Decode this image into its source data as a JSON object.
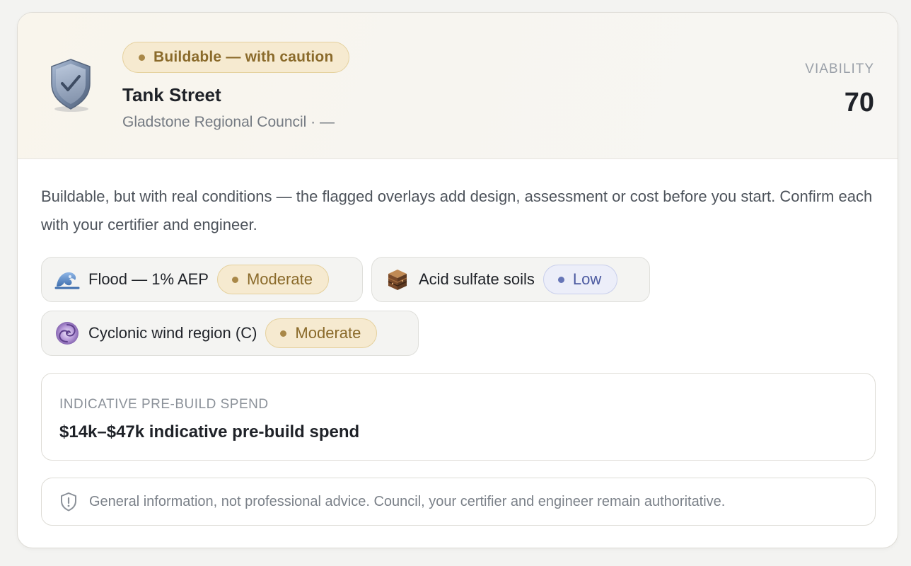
{
  "header": {
    "verdict": "Buildable — with caution",
    "site_name": "Tank Street",
    "site_sub": "Gladstone Regional Council · —",
    "viability_label": "VIABILITY",
    "viability_value": "70",
    "shield_icon": "shield-check-icon"
  },
  "summary": "Buildable, but with real conditions — the flagged overlays add design, assessment or cost before you start. Confirm each with your certifier and engineer.",
  "overlays": [
    {
      "label": "Flood — 1% AEP",
      "severity": "Moderate",
      "icon": "flood-wave-icon"
    },
    {
      "label": "Acid sulfate soils",
      "severity": "Low",
      "icon": "soil-layers-icon"
    },
    {
      "label": "Cyclonic wind region (C)",
      "severity": "Moderate",
      "icon": "cyclone-icon"
    }
  ],
  "spend": {
    "label": "INDICATIVE PRE-BUILD SPEND",
    "value": "$14k–$47k indicative pre-build spend"
  },
  "disclaimer": {
    "text": "General information, not professional advice. Council, your certifier and engineer remain authoritative.",
    "icon": "shield-alert-icon"
  },
  "colors": {
    "caution_accent": "#8a6a2a",
    "caution_bg": "#f6ead0",
    "low_accent": "#4c5aa0",
    "low_bg": "#eceef9"
  }
}
